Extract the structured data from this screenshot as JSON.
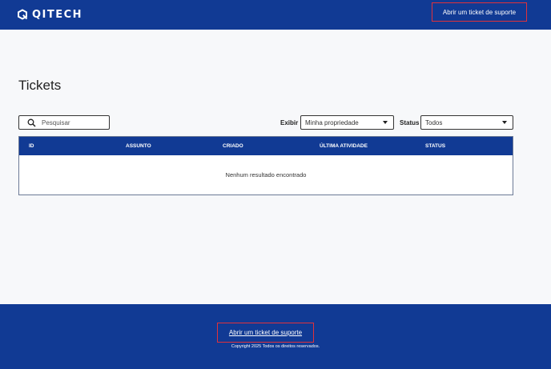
{
  "header": {
    "logo_text": "QITECH",
    "support_link": "Abrir um ticket de suporte"
  },
  "page": {
    "title": "Tickets"
  },
  "filters": {
    "search_placeholder": "Pesquisar",
    "exibir_label": "Exibir",
    "exibir_value": "Minha propriedade",
    "status_label": "Status",
    "status_value": "Todos"
  },
  "table": {
    "columns": [
      "ID",
      "ASSUNTO",
      "CRIADO",
      "ÚLTIMA ATIVIDADE",
      "STATUS"
    ],
    "rows": [],
    "empty_message": "Nenhum resultado encontrado"
  },
  "footer": {
    "support_link": "Abrir um ticket de suporte",
    "copyright": "Copyright 2025 Todos os direitos reservados."
  },
  "colors": {
    "brand_blue": "#113a94",
    "highlight_red": "#e0313b",
    "background": "#f7f8fa"
  },
  "icons": {
    "logo": "qitech-logo-icon",
    "search": "search-icon",
    "dropdown": "caret-down-icon"
  }
}
